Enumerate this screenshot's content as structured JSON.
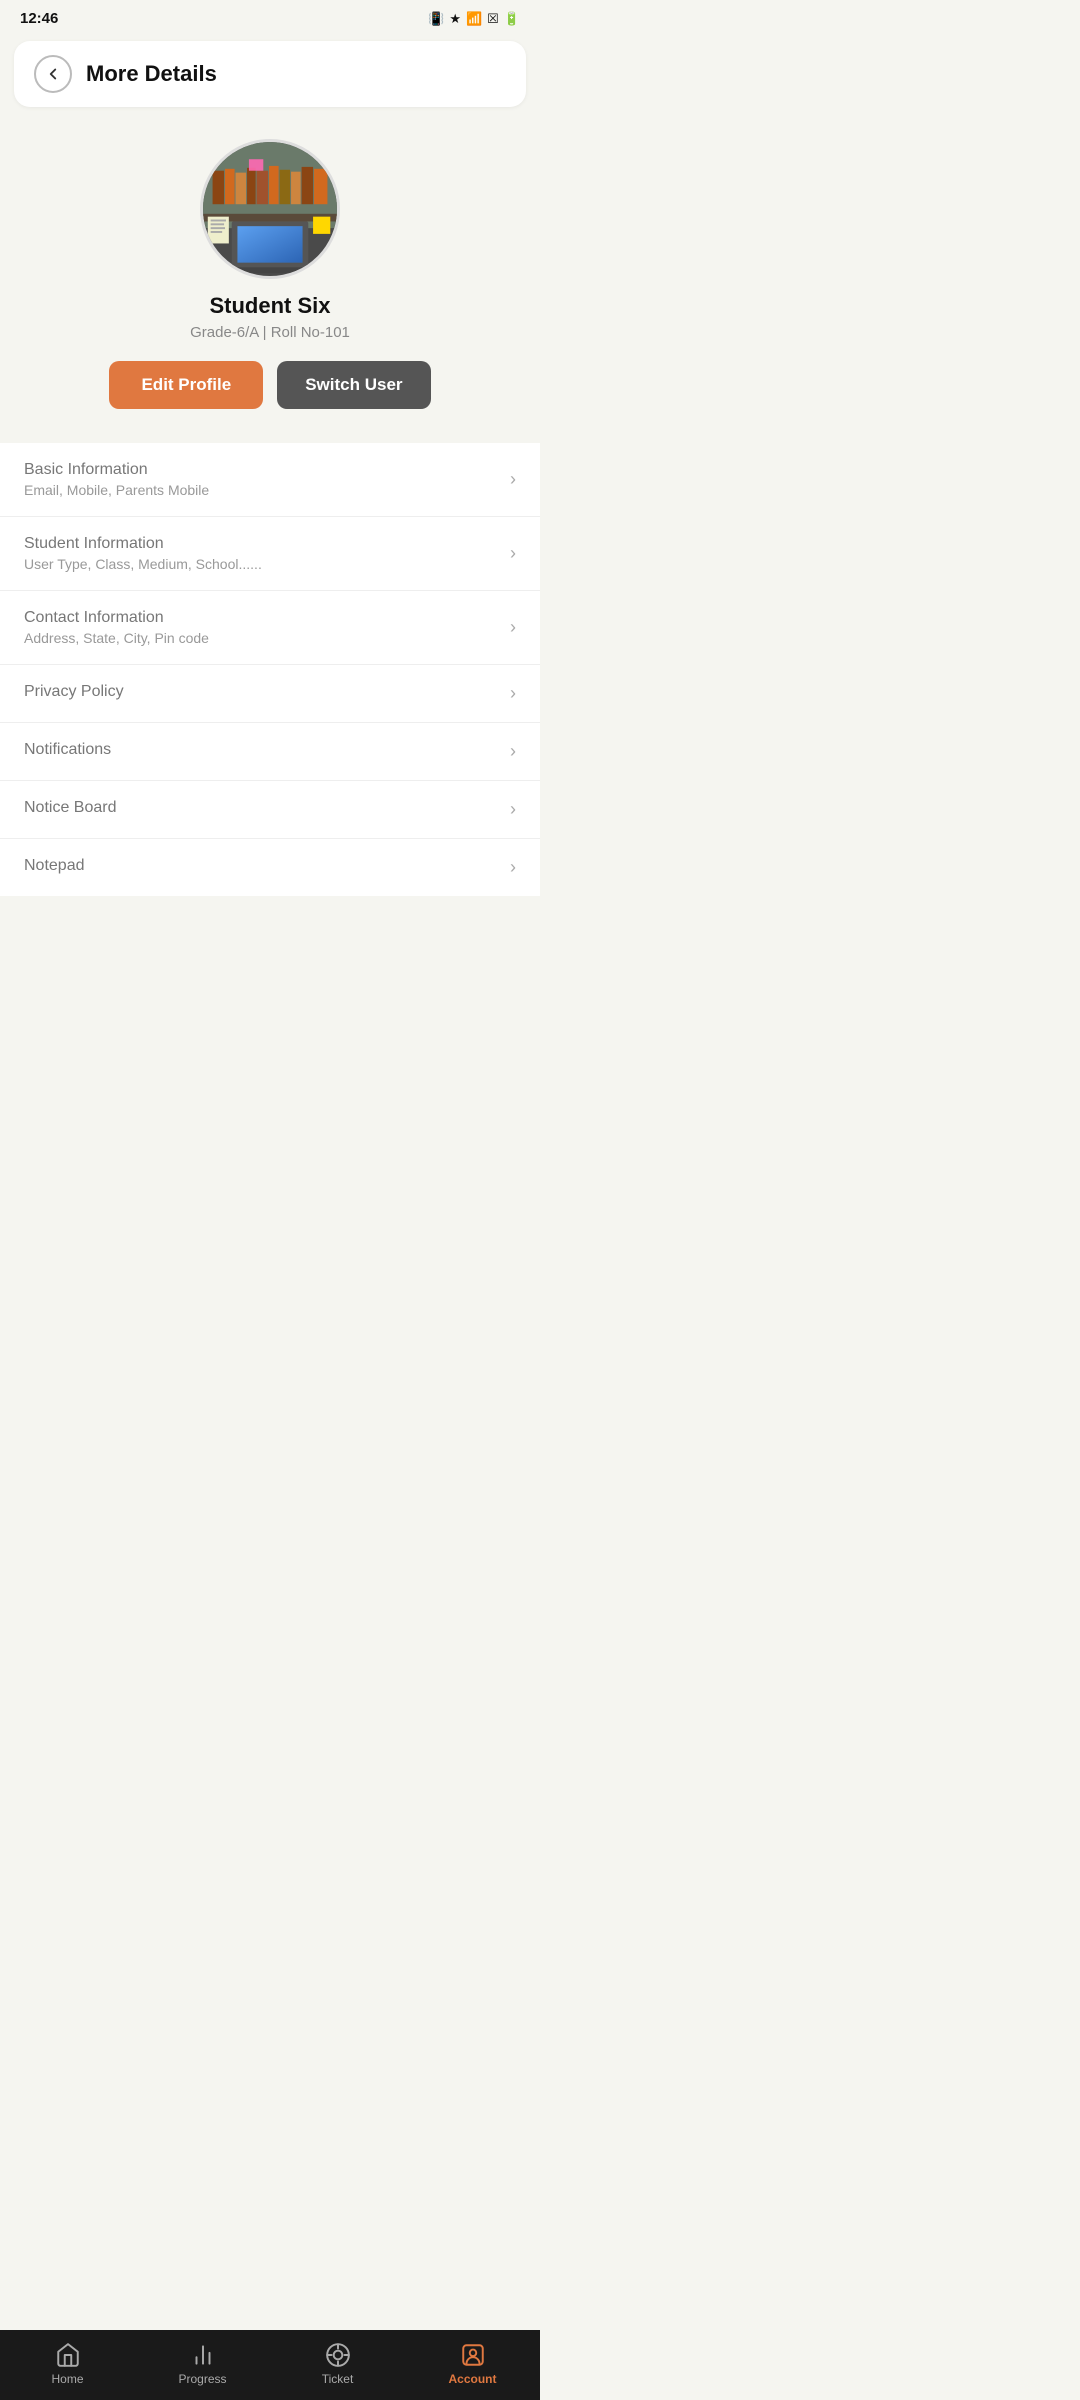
{
  "statusBar": {
    "time": "12:46",
    "icons": [
      "vibrate",
      "bluetooth",
      "wifi",
      "signal",
      "battery"
    ]
  },
  "header": {
    "backLabel": "‹",
    "title": "More Details"
  },
  "profile": {
    "name": "Student Six",
    "grade": "Grade-6/A | Roll No-101",
    "editButtonLabel": "Edit Profile",
    "switchButtonLabel": "Switch User"
  },
  "menuItems": [
    {
      "title": "Basic Information",
      "subtitle": "Email, Mobile, Parents Mobile",
      "hasSubtitle": true
    },
    {
      "title": "Student Information",
      "subtitle": "User Type, Class, Medium, School......",
      "hasSubtitle": true
    },
    {
      "title": "Contact Information",
      "subtitle": "Address, State, City, Pin code",
      "hasSubtitle": true
    },
    {
      "title": "Privacy Policy",
      "subtitle": "",
      "hasSubtitle": false
    },
    {
      "title": "Notifications",
      "subtitle": "",
      "hasSubtitle": false
    },
    {
      "title": "Notice Board",
      "subtitle": "",
      "hasSubtitle": false
    },
    {
      "title": "Notepad",
      "subtitle": "",
      "hasSubtitle": false
    }
  ],
  "bottomNav": {
    "items": [
      {
        "label": "Home",
        "icon": "home",
        "active": false
      },
      {
        "label": "Progress",
        "icon": "progress",
        "active": false
      },
      {
        "label": "Ticket",
        "icon": "ticket",
        "active": false
      },
      {
        "label": "Account",
        "icon": "account",
        "active": true
      }
    ]
  }
}
